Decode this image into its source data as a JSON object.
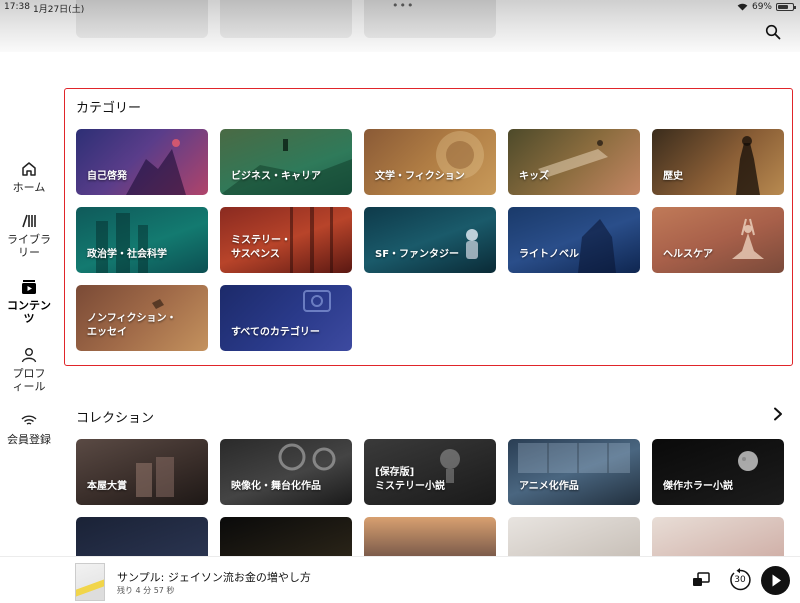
{
  "status_bar": {
    "time": "17:38",
    "date": "1月27日(土)",
    "battery": "69%"
  },
  "sidebar": {
    "items": [
      {
        "label": "ホーム",
        "icon": "home-icon"
      },
      {
        "label": "ライブラリー",
        "icon": "library-icon"
      },
      {
        "label": "コンテンツ",
        "icon": "contents-icon",
        "active": true
      },
      {
        "label": "プロフィール",
        "icon": "profile-icon"
      },
      {
        "label": "会員登録",
        "icon": "membership-icon"
      }
    ]
  },
  "categories": {
    "title": "カテゴリー",
    "items": [
      {
        "label": "自己啓発"
      },
      {
        "label": "ビジネス・キャリア"
      },
      {
        "label": "文学・フィクション"
      },
      {
        "label": "キッズ"
      },
      {
        "label": "歴史"
      },
      {
        "label": "政治学・社会科学"
      },
      {
        "label": "ミステリー・\nサスペンス"
      },
      {
        "label": "SF・ファンタジー"
      },
      {
        "label": "ライトノベル"
      },
      {
        "label": "ヘルスケア"
      },
      {
        "label": "ノンフィクション・\nエッセイ"
      },
      {
        "label": "すべてのカテゴリー"
      }
    ]
  },
  "collections": {
    "title": "コレクション",
    "items": [
      {
        "label": "本屋大賞"
      },
      {
        "label": "映像化・舞台化作品"
      },
      {
        "label": "[保存版]\nミステリー小説"
      },
      {
        "label": "アニメ化作品"
      },
      {
        "label": "傑作ホラー小説"
      }
    ]
  },
  "player": {
    "title": "サンプル: ジェイソン流お金の増やし方",
    "remaining": "残り 4 分 57 秒",
    "skip_back_seconds": "30"
  }
}
